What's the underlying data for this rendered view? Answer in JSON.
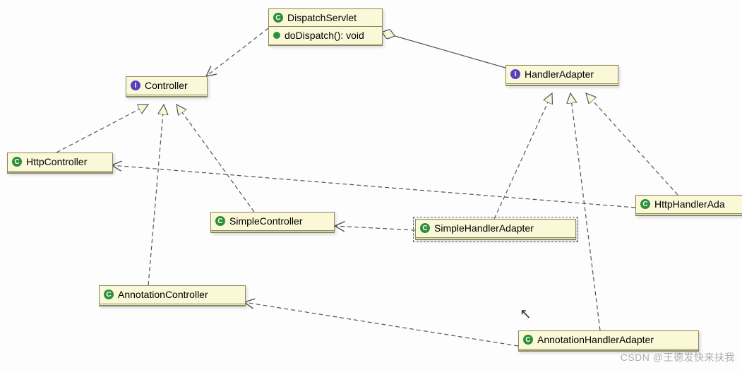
{
  "diagram": {
    "nodes": {
      "dispatchServlet": {
        "name": "DispatchServlet",
        "method": "doDispatch(): void",
        "stereotype": "class"
      },
      "controller": {
        "name": "Controller",
        "stereotype": "interface"
      },
      "handlerAdapter": {
        "name": "HandlerAdapter",
        "stereotype": "interface"
      },
      "httpController": {
        "name": "HttpController",
        "stereotype": "class"
      },
      "simpleController": {
        "name": "SimpleController",
        "stereotype": "class"
      },
      "annotationController": {
        "name": "AnnotationController",
        "stereotype": "class"
      },
      "simpleHandlerAdapter": {
        "name": "SimpleHandlerAdapter",
        "stereotype": "class"
      },
      "httpHandlerAdapter": {
        "name": "HttpHandlerAda",
        "stereotype": "class"
      },
      "annotationHandlerAdapter": {
        "name": "AnnotationHandlerAdapter",
        "stereotype": "class"
      }
    },
    "icons": {
      "class": "C",
      "interface": "I"
    },
    "relationships": [
      {
        "from": "dispatchServlet",
        "to": "controller",
        "type": "dependency"
      },
      {
        "from": "dispatchServlet",
        "to": "handlerAdapter",
        "type": "aggregation"
      },
      {
        "from": "httpController",
        "to": "controller",
        "type": "realization"
      },
      {
        "from": "simpleController",
        "to": "controller",
        "type": "realization"
      },
      {
        "from": "annotationController",
        "to": "controller",
        "type": "realization"
      },
      {
        "from": "simpleHandlerAdapter",
        "to": "handlerAdapter",
        "type": "realization"
      },
      {
        "from": "httpHandlerAdapter",
        "to": "handlerAdapter",
        "type": "realization"
      },
      {
        "from": "annotationHandlerAdapter",
        "to": "handlerAdapter",
        "type": "realization"
      },
      {
        "from": "httpHandlerAdapter",
        "to": "httpController",
        "type": "dependency"
      },
      {
        "from": "simpleHandlerAdapter",
        "to": "simpleController",
        "type": "dependency"
      },
      {
        "from": "annotationHandlerAdapter",
        "to": "annotationController",
        "type": "dependency"
      }
    ]
  },
  "watermark": "CSDN @王德发快来扶我"
}
